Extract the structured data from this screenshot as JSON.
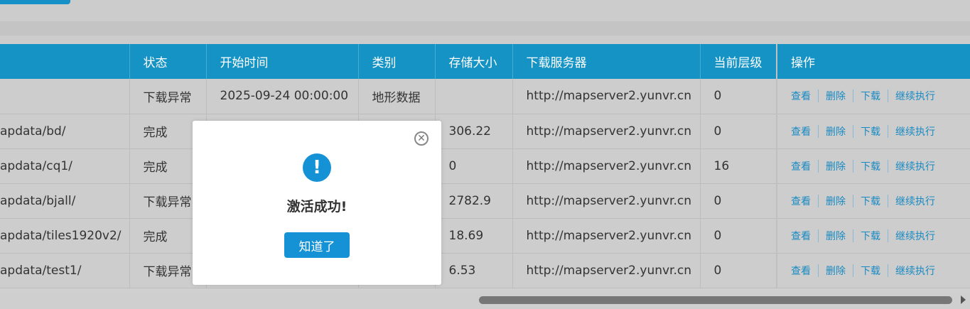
{
  "table": {
    "headers": [
      "",
      "状态",
      "开始时间",
      "类别",
      "存储大小",
      "下载服务器",
      "当前层级",
      "操作"
    ],
    "rows": [
      {
        "path": "",
        "status": "下载异常",
        "start": "2025-09-24 00:00:00",
        "category": "地形数据",
        "size": "",
        "server": "http://mapserver2.yunvr.cn",
        "level": "0"
      },
      {
        "path": "apdata/bd/",
        "status": "完成",
        "start": "",
        "category": "",
        "size": "306.22",
        "server": "http://mapserver2.yunvr.cn",
        "level": "0"
      },
      {
        "path": "apdata/cq1/",
        "status": "完成",
        "start": "",
        "category": "",
        "size": "0",
        "server": "http://mapserver2.yunvr.cn",
        "level": "16"
      },
      {
        "path": "apdata/bjall/",
        "status": "下载异常",
        "start": "",
        "category": "",
        "size": "2782.9",
        "server": "http://mapserver2.yunvr.cn",
        "level": "0"
      },
      {
        "path": "apdata/tiles1920v2/",
        "status": "完成",
        "start": "",
        "category": "",
        "size": "18.69",
        "server": "http://mapserver2.yunvr.cn",
        "level": "0"
      },
      {
        "path": "apdata/test1/",
        "status": "下载异常",
        "start": "",
        "category": "",
        "size": "6.53",
        "server": "http://mapserver2.yunvr.cn",
        "level": "0"
      }
    ],
    "actions": [
      "查看",
      "删除",
      "下载",
      "继续执行"
    ]
  },
  "dialog": {
    "icon": "info-exclamation-icon",
    "close_glyph": "✕",
    "exclamation": "!",
    "message": "激活成功!",
    "ok_label": "知道了"
  },
  "colors": {
    "header_bg": "#1493c4",
    "accent": "#1591d6",
    "link": "#1a8ac2",
    "row_bg": "#cdcdcd"
  }
}
